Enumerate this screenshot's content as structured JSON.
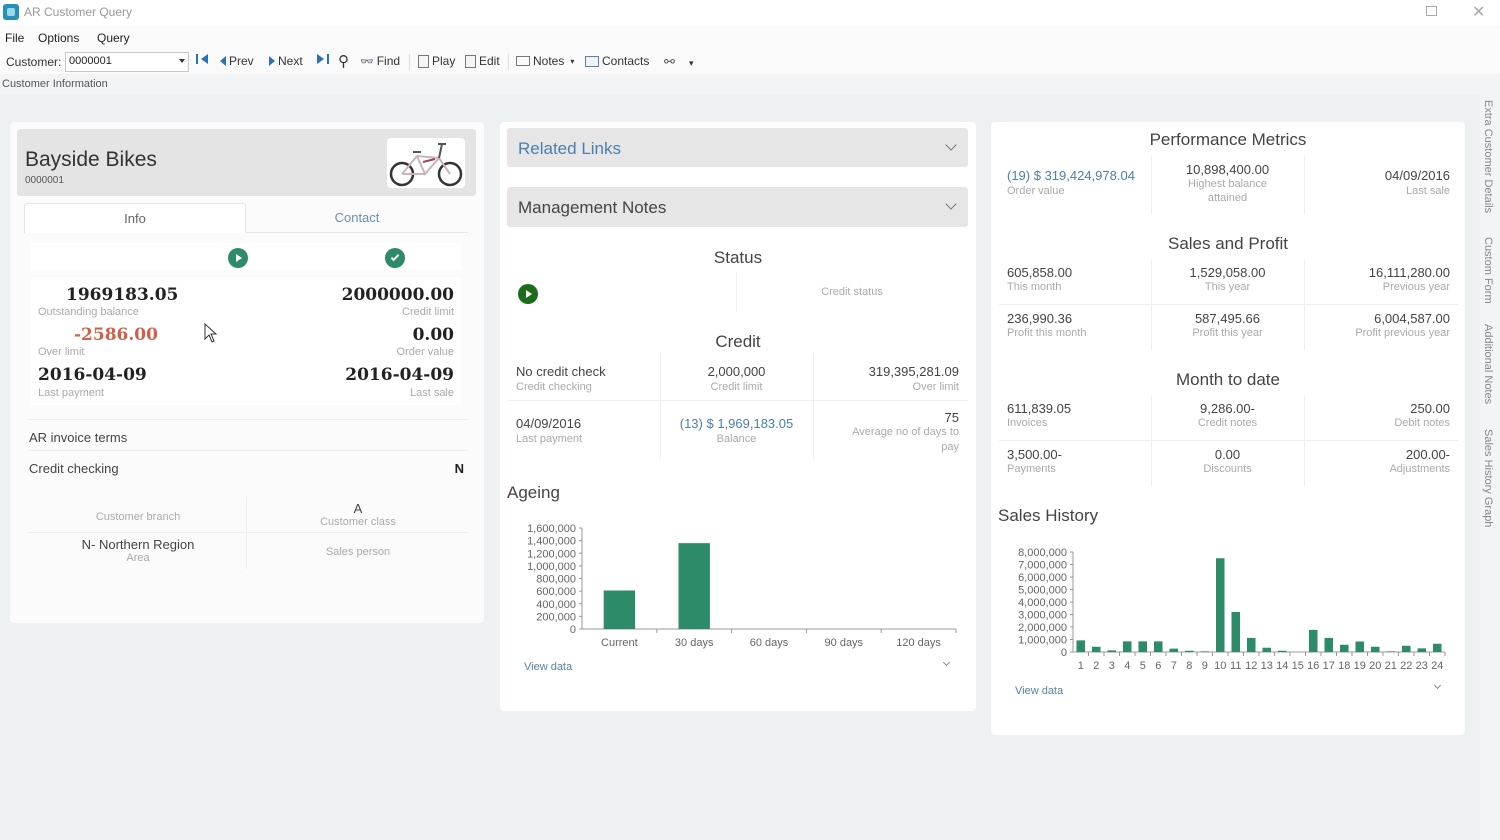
{
  "window": {
    "title": "AR Customer Query"
  },
  "menu": [
    "File",
    "Options",
    "Query"
  ],
  "toolbar": {
    "customer_label": "Customer:",
    "customer_value": "0000001",
    "prev": "Prev",
    "next": "Next",
    "find": "Find",
    "play": "Play",
    "edit": "Edit",
    "notes": "Notes",
    "contacts": "Contacts"
  },
  "sub_header": "Customer Information",
  "customer": {
    "name": "Bayside Bikes",
    "code": "0000001",
    "tabs": [
      "Info",
      "Contact"
    ],
    "kpis": {
      "outstanding_balance": {
        "value": "1969183.05",
        "label": "Outstanding balance"
      },
      "credit_limit": {
        "value": "2000000.00",
        "label": "Credit limit"
      },
      "over_limit": {
        "value": "-2586.00",
        "label": "Over limit"
      },
      "order_value": {
        "value": "0.00",
        "label": "Order value"
      },
      "last_payment": {
        "value": "2016-04-09",
        "label": "Last payment"
      },
      "last_sale": {
        "value": "2016-04-09",
        "label": "Last sale"
      }
    },
    "ar_invoice_terms_label": "AR invoice terms",
    "credit_checking_label": "Credit checking",
    "credit_checking_value": "N",
    "grid": {
      "customer_branch_label": "Customer branch",
      "customer_class_value": "A",
      "customer_class_label": "Customer class",
      "area_value": "N- Northern Region",
      "area_label": "Area",
      "sales_person_label": "Sales person"
    }
  },
  "middle": {
    "related_links": "Related Links",
    "management_notes": "Management Notes",
    "status_title": "Status",
    "credit_status_label": "Credit status",
    "credit_title": "Credit",
    "credit": {
      "checking_value": "No credit check",
      "checking_label": "Credit checking",
      "limit_value": "2,000,000",
      "limit_label": "Credit limit",
      "over_value": "319,395,281.09",
      "over_label": "Over limit",
      "last_payment_value": "04/09/2016",
      "last_payment_label": "Last payment",
      "balance_value": "(13) $ 1,969,183.05",
      "balance_label": "Balance",
      "avg_days_value": "75",
      "avg_days_label_1": "Average no of days to",
      "avg_days_label_2": "pay"
    },
    "ageing_title": "Ageing",
    "view_data": "View data"
  },
  "right": {
    "performance_title": "Performance Metrics",
    "performance": {
      "order_value": "(19) $ 319,424,978.04",
      "order_label": "Order value",
      "highest_value": "10,898,400.00",
      "highest_label_1": "Highest balance",
      "highest_label_2": "attained",
      "last_sale_value": "04/09/2016",
      "last_sale_label": "Last sale"
    },
    "sales_title": "Sales and Profit",
    "sales": [
      {
        "value": "605,858.00",
        "label": "This month"
      },
      {
        "value": "1,529,058.00",
        "label": "This year"
      },
      {
        "value": "16,111,280.00",
        "label": "Previous year"
      },
      {
        "value": "236,990.36",
        "label": "Profit this month"
      },
      {
        "value": "587,495.66",
        "label": "Profit this year"
      },
      {
        "value": "6,004,587.00",
        "label": "Profit previous year"
      }
    ],
    "mtd_title": "Month to date",
    "mtd": [
      {
        "value": "611,839.05",
        "label": "Invoices"
      },
      {
        "value": "9,286.00-",
        "label": "Credit notes"
      },
      {
        "value": "250.00",
        "label": "Debit notes"
      },
      {
        "value": "3,500.00-",
        "label": "Payments"
      },
      {
        "value": "0.00",
        "label": "Discounts"
      },
      {
        "value": "200.00-",
        "label": "Adjustments"
      }
    ],
    "sales_history_title": "Sales History",
    "view_data": "View data"
  },
  "side_tabs": [
    "Extra Customer Details",
    "Custom Form",
    "Additional Notes",
    "Sales History Graph"
  ],
  "colors": {
    "accent_green": "#2e8b6a",
    "link_blue": "#4a7fb0",
    "negative_red": "#d0604a"
  },
  "chart_data": [
    {
      "type": "bar",
      "title": "Ageing",
      "categories": [
        "Current",
        "30 days",
        "60 days",
        "90 days",
        "120 days"
      ],
      "values": [
        610000,
        1360000,
        0,
        0,
        0
      ],
      "ylim": [
        0,
        1600000
      ],
      "yticks": [
        "0",
        "200,000",
        "400,000",
        "600,000",
        "800,000",
        "1,000,000",
        "1,200,000",
        "1,400,000",
        "1,600,000"
      ],
      "xlabel": "",
      "ylabel": "",
      "grid": false,
      "color": "#2e8b6a"
    },
    {
      "type": "bar",
      "title": "Sales History",
      "categories": [
        "1",
        "2",
        "3",
        "4",
        "5",
        "6",
        "7",
        "8",
        "9",
        "10",
        "11",
        "12",
        "13",
        "14",
        "15",
        "16",
        "17",
        "18",
        "19",
        "20",
        "21",
        "22",
        "23",
        "24"
      ],
      "values": [
        930000,
        420000,
        130000,
        850000,
        850000,
        850000,
        270000,
        100000,
        50000,
        7500000,
        3200000,
        1130000,
        340000,
        100000,
        0,
        1770000,
        1130000,
        580000,
        840000,
        420000,
        50000,
        500000,
        290000,
        660000
      ],
      "ylim": [
        0,
        8000000
      ],
      "yticks": [
        "0",
        "1,000,000",
        "2,000,000",
        "3,000,000",
        "4,000,000",
        "5,000,000",
        "6,000,000",
        "7,000,000",
        "8,000,000"
      ],
      "xlabel": "",
      "ylabel": "",
      "grid": false,
      "color": "#2e8b6a"
    }
  ]
}
